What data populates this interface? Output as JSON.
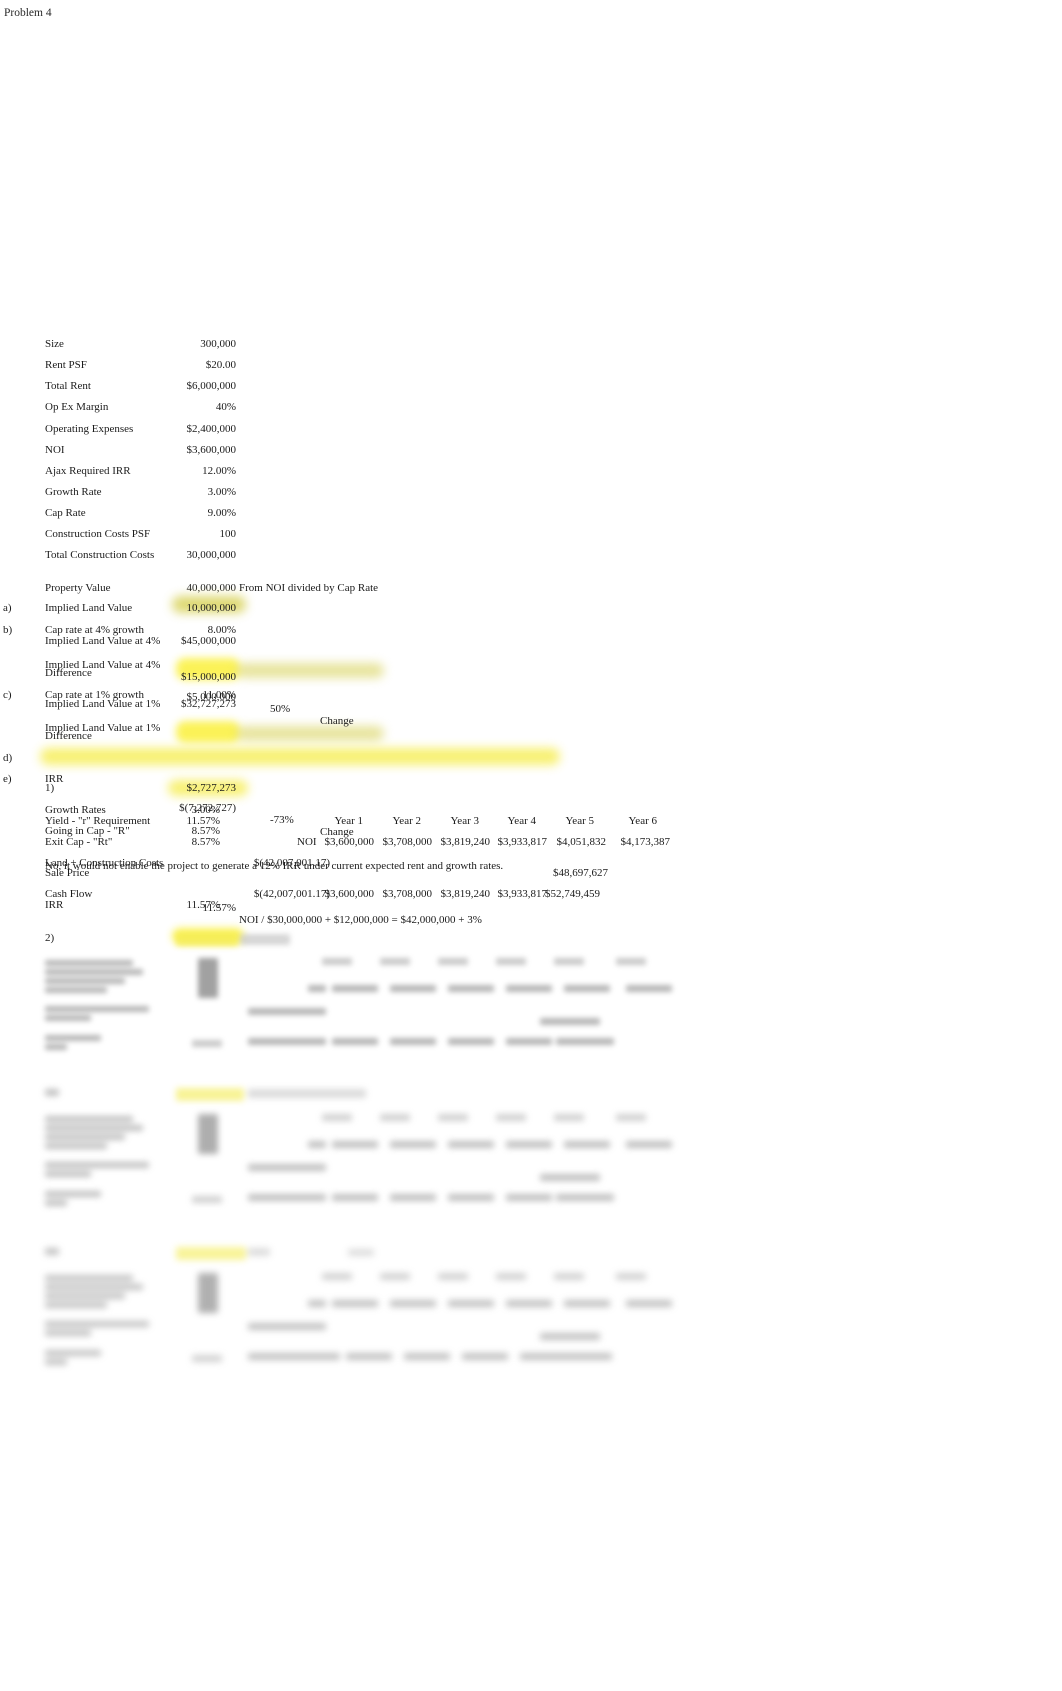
{
  "document": {
    "title": "Problem 4"
  },
  "assumptions": {
    "rows": [
      {
        "label": "Size",
        "value": "300,000"
      },
      {
        "label": "Rent PSF",
        "value": "$20.00"
      },
      {
        "label": "Total Rent",
        "value": "$6,000,000"
      },
      {
        "label": "Op Ex Margin",
        "value": "40%"
      },
      {
        "label": "Operating Expenses",
        "value": "$2,400,000"
      },
      {
        "label": "NOI",
        "value": "$3,600,000"
      },
      {
        "label": "Ajax Required IRR",
        "value": "12.00%"
      },
      {
        "label": "Growth Rate",
        "value": "3.00%"
      },
      {
        "label": "Cap Rate",
        "value": "9.00%"
      },
      {
        "label": "Construction Costs PSF",
        "value": "100"
      },
      {
        "label": "Total Construction Costs",
        "value": "30,000,000"
      }
    ]
  },
  "property_value": {
    "label": "Property Value",
    "value": "40,000,000",
    "note": "From NOI divided by Cap Rate"
  },
  "part_a": {
    "letter": "a)",
    "label": "Implied Land Value",
    "value": "10,000,000"
  },
  "part_b": {
    "letter": "b)",
    "cap_rate_label": "Cap rate at 4% growth",
    "cap_rate_value": "8.00%",
    "implied_label": "Implied Land Value at 4%",
    "implied_value": "$45,000,000",
    "implied2_label": "Implied Land Value at 4%",
    "implied2_value": "$15,000,000",
    "difference_label": "Difference",
    "difference_value": "$5,000,000",
    "percent": "50%",
    "change_label": "Change"
  },
  "part_c": {
    "letter": "c)",
    "cap_rate_label": "Cap rate at 1% growth",
    "cap_rate_value": "11.00%",
    "implied_label": "Implied Land Value at 1%",
    "implied_value": "$32,727,273",
    "implied2_label": "Implied Land Value at 1%",
    "implied2_value": "$2,727,273",
    "difference_label": "Difference",
    "difference_value": "$(7,272,727)",
    "percent": "-73%",
    "change_label": "Change"
  },
  "part_d": {
    "letter": "d)",
    "statement": "No, it would not enable the project to generate a 12% IRR under current expected rent and growth rates."
  },
  "part_e": {
    "letter": "e)",
    "heading": "IRR",
    "item1_label": "1)",
    "item1_value": "11.57%",
    "item1_note": "NOI / $30,000,000 + $12,000,000 = $42,000,000 + 3%",
    "item2_label": "2)",
    "rates": [
      {
        "label": "Growth Rates",
        "value": "3.00%"
      },
      {
        "label": "Yield - \"r\" Requirement",
        "value": "11.57%"
      },
      {
        "label": "Going in Cap - \"R\"",
        "value": "8.57%"
      },
      {
        "label": "Exit Cap - \"Rt\"",
        "value": "8.57%"
      }
    ],
    "year_headers": [
      "Year 1",
      "Year 2",
      "Year 3",
      "Year 4",
      "Year 5",
      "Year 6"
    ],
    "noi_label": "NOI",
    "noi_values": [
      "$3,600,000",
      "$3,708,000",
      "$3,819,240",
      "$3,933,817",
      "$4,051,832",
      "$4,173,387"
    ],
    "land_construction_label": "Land + Construction Costs",
    "land_construction_value": "$(42,007,001.17)",
    "sale_price_label": "Sale Price",
    "sale_price_value": "$48,697,627",
    "cash_flow_label": "Cash Flow",
    "cash_flow_values": [
      "$(42,007,001.17)",
      "$3,600,000",
      "$3,708,000",
      "$3,819,240",
      "$3,933,817",
      "$52,749,459"
    ],
    "irr_label": "IRR",
    "irr_value": "11.57%"
  },
  "colors": {
    "highlight_yellow": "#fbf250",
    "highlight_olive": "#d8d25a",
    "text": "#1b1b1b"
  }
}
